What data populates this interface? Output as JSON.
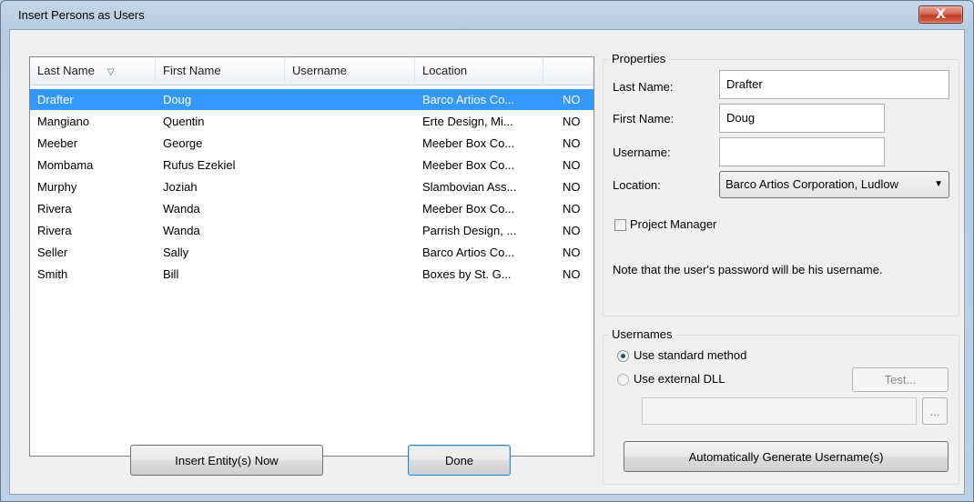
{
  "window": {
    "title": "Insert Persons as Users",
    "close_label": "X"
  },
  "list": {
    "columns": [
      "Last Name",
      "First Name",
      "Username",
      "Location"
    ],
    "sort_icon": "sort-ascending-icon",
    "rows": [
      {
        "last": "Drafter",
        "first": "Doug",
        "username": "",
        "location": "Barco Artios Co...",
        "flag": "NO"
      },
      {
        "last": "Mangiano",
        "first": "Quentin",
        "username": "",
        "location": "Erte Design, Mi...",
        "flag": "NO"
      },
      {
        "last": "Meeber",
        "first": "George",
        "username": "",
        "location": "Meeber Box Co...",
        "flag": "NO"
      },
      {
        "last": "Mombama",
        "first": "Rufus Ezekiel",
        "username": "",
        "location": "Meeber Box Co...",
        "flag": "NO"
      },
      {
        "last": "Murphy",
        "first": "Joziah",
        "username": "",
        "location": "Slambovian Ass...",
        "flag": "NO"
      },
      {
        "last": "Rivera",
        "first": "Wanda",
        "username": "",
        "location": "Meeber Box Co...",
        "flag": "NO"
      },
      {
        "last": "Rivera",
        "first": "Wanda",
        "username": "",
        "location": "Parrish Design, ...",
        "flag": "NO"
      },
      {
        "last": "Seller",
        "first": "Sally",
        "username": "",
        "location": "Barco Artios Co...",
        "flag": "NO"
      },
      {
        "last": "Smith",
        "first": "Bill",
        "username": "",
        "location": "Boxes by St. G...",
        "flag": "NO"
      }
    ]
  },
  "buttons": {
    "insert": "Insert Entity(s) Now",
    "done": "Done"
  },
  "properties": {
    "title": "Properties",
    "last_name_label": "Last Name:",
    "last_name_value": "Drafter",
    "first_name_label": "First Name:",
    "first_name_value": "Doug",
    "username_label": "Username:",
    "username_value": "",
    "location_label": "Location:",
    "location_value": "Barco Artios Corporation, Ludlow",
    "project_manager_label": "Project Manager",
    "note": "Note that the user's password will be his username."
  },
  "usernames": {
    "title": "Usernames",
    "standard_label": "Use standard method",
    "external_label": "Use external DLL",
    "test_label": "Test...",
    "browse_label": "...",
    "generate_label": "Automatically Generate Username(s)"
  },
  "colors": {
    "selection": "#3399ff",
    "default_button_border": "#3c7fb1"
  }
}
